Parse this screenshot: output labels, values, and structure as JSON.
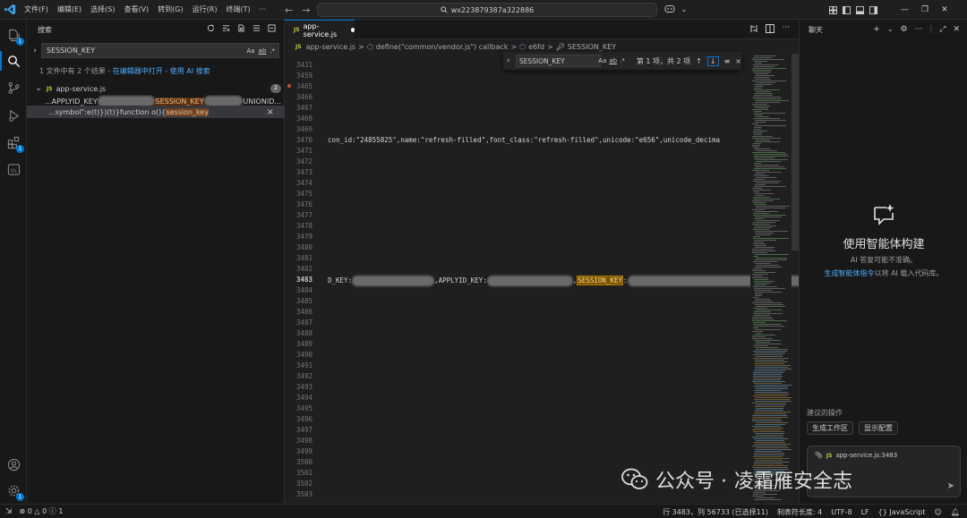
{
  "menu": [
    "文件(F)",
    "编辑(E)",
    "选择(S)",
    "查看(V)",
    "转到(G)",
    "运行(R)",
    "终端(T)",
    "···"
  ],
  "command_center": "wx223879387a322886",
  "sidebar": {
    "title": "搜索",
    "query": "SESSION_KEY",
    "opt_case": "Aa",
    "opt_word": "ab",
    "opt_regex": ".*",
    "results_msg": "1 文件中有 2 个结果 - ",
    "results_link": "在编辑器中打开 - 使用 AI 搜索",
    "file_name": "app-service.js",
    "file_type": "JS",
    "match_count": "2",
    "match1_prefix": "...APPLYID_KEY",
    "match1_hl": "SESSION_KEY",
    "match1_suffix": "UNIONID...",
    "match2_prefix": "...symbol\":e(t)})(t)}function o(){",
    "match2_hl": "session_key",
    "close": "×"
  },
  "editor": {
    "tab_label": "app-service.js",
    "tab_type": "JS",
    "breadcrumb": [
      "app-service.js",
      "define(\"common/vendor.js\") callback",
      "e6fd",
      "SESSION_KEY"
    ],
    "breadcrumb_sep": ">",
    "find": {
      "query": "SESSION_KEY",
      "opt_case": "Aa",
      "opt_word": "ab",
      "opt_regex": ".*",
      "count": "第 1 项，共 2 项",
      "prev": "↑",
      "next": "↓",
      "menu": "≡",
      "close": "×"
    },
    "line_numbers": [
      "3431",
      "3459",
      "3465",
      "3466",
      "3467",
      "3468",
      "3469",
      "3470",
      "3471",
      "3472",
      "3473",
      "3474",
      "3475",
      "3476",
      "3477",
      "3478",
      "3479",
      "3480",
      "3481",
      "3482",
      "3483",
      "3484",
      "3485",
      "3486",
      "3487",
      "3488",
      "3489",
      "3490",
      "3491",
      "3492",
      "3493",
      "3494",
      "3495",
      "3496",
      "3497",
      "3498",
      "3499",
      "3500",
      "3501",
      "3502",
      "3503"
    ],
    "line_3470": "con_id:\"24855825\",name:\"refresh-filled\",font_class:\"refresh-filled\",unicode:\"e656\",unicode_decima",
    "line_3483_a": "D_KEY:",
    "line_3483_b": ",APPLYID_KEY:",
    "line_3483_c": ",",
    "line_3483_hl": "SESSION_KEY",
    "line_3483_d": ":"
  },
  "chat": {
    "title": "聊天",
    "heading": "使用智能体构建",
    "sub1": "AI 答复可能不准确。",
    "sub2_link": "生成智能体指令",
    "sub2_rest": "以将 AI 载入代码库。",
    "suggest_label": "建议的操作",
    "chip1": "生成工作区",
    "chip2": "显示配置",
    "ctx_file": "app-service.js:3483",
    "send": "➤"
  },
  "status": {
    "errors": "0",
    "warnings": "0",
    "info": "1",
    "position": "行 3483，列 56733 (已选择11)",
    "tab_size": "制表符长度: 4",
    "encoding": "UTF-8",
    "eol": "LF",
    "language": "JavaScript"
  },
  "watermark": {
    "prefix": "公众号 ·",
    "name": "凌霜雁安全志"
  },
  "colors": {
    "accent": "#0078d4",
    "match_highlight": "#7a5400",
    "link": "#4daafc"
  }
}
